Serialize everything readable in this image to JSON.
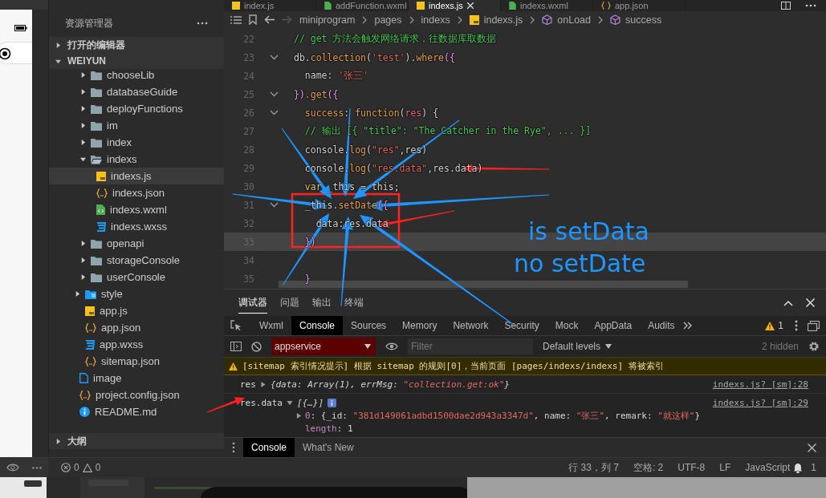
{
  "editor_tabs": [
    {
      "label": "index.js",
      "kind": "js",
      "selected": false
    },
    {
      "label": "addFunction.wxml",
      "kind": "wxml",
      "selected": false
    },
    {
      "label": "indexs.js",
      "kind": "js",
      "selected": true
    },
    {
      "label": "indexs.wxml",
      "kind": "wxml",
      "selected": false
    },
    {
      "label": "app.json",
      "kind": "json",
      "selected": false
    }
  ],
  "breadcrumb": [
    {
      "label": "miniprogram",
      "kind": "folder"
    },
    {
      "label": "pages",
      "kind": "folder"
    },
    {
      "label": "indexs",
      "kind": "folder"
    },
    {
      "label": "indexs.js",
      "kind": "js"
    },
    {
      "label": "onLoad",
      "kind": "symbol"
    },
    {
      "label": "success",
      "kind": "symbol"
    }
  ],
  "explorer": {
    "title": "资源管理器",
    "sections": [
      {
        "label": "打开的编辑器",
        "expanded": false
      },
      {
        "label": "WEIYUN",
        "expanded": true
      }
    ],
    "tree": [
      {
        "children": [
          {
            "children": [
              {
                "label": "chooseLib",
                "kind": "folder",
                "expanded": false,
                "selected": false
              },
              {
                "label": "databaseGuide",
                "kind": "folder",
                "expanded": false,
                "selected": false
              },
              {
                "label": "deployFunctions",
                "kind": "folder",
                "expanded": false,
                "selected": false
              },
              {
                "label": "im",
                "kind": "folder",
                "expanded": false,
                "selected": false
              },
              {
                "label": "index",
                "kind": "folder",
                "expanded": false,
                "selected": false
              },
              {
                "label": "indexs",
                "kind": "folder",
                "expanded": true,
                "selected": false,
                "children": [
                  {
                    "label": "indexs.js",
                    "kind": "js",
                    "selected": true
                  },
                  {
                    "label": "indexs.json",
                    "kind": "json",
                    "selected": false
                  },
                  {
                    "label": "indexs.wxml",
                    "kind": "wxml",
                    "selected": false
                  },
                  {
                    "label": "indexs.wxss",
                    "kind": "wxss",
                    "selected": false
                  }
                ]
              },
              {
                "label": "openapi",
                "kind": "folder",
                "expanded": false,
                "selected": false
              },
              {
                "label": "storageConsole",
                "kind": "folder",
                "expanded": false,
                "selected": false
              },
              {
                "label": "userConsole",
                "kind": "folder",
                "expanded": false,
                "selected": false
              }
            ]
          },
          {
            "label": "style",
            "kind": "style-folder",
            "expanded": false,
            "selected": false
          },
          {
            "label": "app.js",
            "kind": "js",
            "selected": false
          },
          {
            "label": "app.json",
            "kind": "json",
            "selected": false
          },
          {
            "label": "app.wxss",
            "kind": "wxss",
            "selected": false
          },
          {
            "label": "sitemap.json",
            "kind": "json",
            "selected": false
          }
        ]
      },
      {
        "label": "image",
        "kind": "image",
        "selected": false
      },
      {
        "label": "project.config.json",
        "kind": "json",
        "selected": false
      },
      {
        "label": "README.md",
        "kind": "info",
        "selected": false
      }
    ],
    "outline": {
      "label": "大纲",
      "expanded": false
    }
  },
  "code": [
    {
      "number": "22",
      "fold": false,
      "current": false,
      "segments": [
        {
          "text": "// get 方法会触发网络请求，往数据库取数据",
          "kind": "comment"
        }
      ]
    },
    {
      "number": "23",
      "fold": true,
      "current": false,
      "segments": [
        {
          "text": "db.",
          "kind": "plain"
        },
        {
          "text": "collection",
          "kind": "func"
        },
        {
          "text": "(",
          "kind": "plain"
        },
        {
          "text": "'test'",
          "kind": "string"
        },
        {
          "text": ").",
          "kind": "plain"
        },
        {
          "text": "where",
          "kind": "func"
        },
        {
          "text": "({",
          "kind": "punct"
        }
      ]
    },
    {
      "number": "24",
      "fold": false,
      "current": false,
      "segments": [
        {
          "text": "  name: ",
          "kind": "plain"
        },
        {
          "text": "'张三'",
          "kind": "string"
        }
      ]
    },
    {
      "number": "25",
      "fold": true,
      "current": false,
      "segments": [
        {
          "text": "})",
          "kind": "punct"
        },
        {
          "text": ".get",
          "kind": "func"
        },
        {
          "text": "({",
          "kind": "punct"
        }
      ]
    },
    {
      "number": "26",
      "fold": true,
      "current": false,
      "segments": [
        {
          "text": "  success",
          "kind": "func"
        },
        {
          "text": ": ",
          "kind": "plain"
        },
        {
          "text": "function",
          "kind": "func"
        },
        {
          "text": "(",
          "kind": "plain"
        },
        {
          "text": "res",
          "kind": "param"
        },
        {
          "text": ") {",
          "kind": "plain"
        }
      ]
    },
    {
      "number": "27",
      "fold": false,
      "current": false,
      "segments": [
        {
          "text": "  // 输出 [{ \"title\": \"The Catcher in the Rye\", ... }]",
          "kind": "comment"
        }
      ]
    },
    {
      "number": "28",
      "fold": false,
      "current": false,
      "segments": [
        {
          "text": "  console.",
          "kind": "plain"
        },
        {
          "text": "log",
          "kind": "func"
        },
        {
          "text": "(",
          "kind": "plain"
        },
        {
          "text": "\"res\"",
          "kind": "string"
        },
        {
          "text": ",res)",
          "kind": "plain"
        }
      ]
    },
    {
      "number": "29",
      "fold": false,
      "current": false,
      "segments": [
        {
          "text": "  console.",
          "kind": "plain"
        },
        {
          "text": "log",
          "kind": "func"
        },
        {
          "text": "(",
          "kind": "plain"
        },
        {
          "text": "\"res.data\"",
          "kind": "string"
        },
        {
          "text": ",res.data)",
          "kind": "plain"
        }
      ]
    },
    {
      "number": "30",
      "fold": false,
      "current": false,
      "segments": [
        {
          "text": "  var",
          "kind": "keyword"
        },
        {
          "text": " _this = this;",
          "kind": "plain"
        }
      ]
    },
    {
      "number": "31",
      "fold": true,
      "current": false,
      "segments": [
        {
          "text": "  _this.",
          "kind": "plain"
        },
        {
          "text": "setDate",
          "kind": "func"
        },
        {
          "text": "({",
          "kind": "punct"
        }
      ]
    },
    {
      "number": "32",
      "fold": false,
      "current": false,
      "segments": [
        {
          "text": "    data:res.data",
          "kind": "plain"
        }
      ]
    },
    {
      "number": "33",
      "fold": false,
      "current": true,
      "segments": [
        {
          "text": "  })",
          "kind": "punct"
        }
      ]
    },
    {
      "number": "34",
      "fold": false,
      "current": false
    },
    {
      "number": "35",
      "fold": false,
      "current": false,
      "segments": [
        {
          "text": "  }",
          "kind": "punct"
        }
      ]
    }
  ],
  "annotations": [
    "is setData",
    "no setDate"
  ],
  "devtools": {
    "panel_tabs": [
      {
        "label": "调试器",
        "selected": true
      },
      {
        "label": "问题",
        "selected": false
      },
      {
        "label": "输出",
        "selected": false
      },
      {
        "label": "终端",
        "selected": false
      }
    ],
    "tool_tabs": [
      {
        "label": "Wxml",
        "selected": false
      },
      {
        "label": "Console",
        "selected": true
      },
      {
        "label": "Sources",
        "selected": false
      },
      {
        "label": "Memory",
        "selected": false
      },
      {
        "label": "Network",
        "selected": false
      },
      {
        "label": "Security",
        "selected": false
      },
      {
        "label": "Mock",
        "selected": false
      },
      {
        "label": "AppData",
        "selected": false
      },
      {
        "label": "Audits",
        "selected": false
      }
    ],
    "warning_count": "1",
    "context": "appservice",
    "filter_placeholder": "Filter",
    "levels": "Default levels",
    "hidden": "2 hidden",
    "messages": [
      {
        "kind": "warning",
        "text": "[sitemap 索引情况提示] 根据 sitemap 的规则[0]，当前页面 [pages/indexs/indexs] 将被索引"
      },
      {
        "kind": "log",
        "label": "res",
        "expanded": false,
        "preview": [
          {
            "text": "{data: Array(1), errMsg: ",
            "kind": "plain"
          },
          {
            "text": "\"collection.get:ok\"",
            "kind": "string"
          },
          {
            "text": "}",
            "kind": "plain"
          }
        ],
        "source": "indexs.js? [sm]:28"
      },
      {
        "kind": "log",
        "label": "res.data",
        "expanded": true,
        "info_badge": true,
        "preview": [
          {
            "text": "[{…}]",
            "kind": "plain"
          }
        ],
        "source": "indexs.js? [sm]:29",
        "children": [
          {
            "expanded": false,
            "segments": [
              {
                "text": "0",
                "kind": "key"
              },
              {
                "text": ": {_id: ",
                "kind": "plain"
              },
              {
                "text": "\"381d149061adbd1500dae2d943a3347d\"",
                "kind": "string"
              },
              {
                "text": ", name: ",
                "kind": "plain"
              },
              {
                "text": "\"张三\"",
                "kind": "string"
              },
              {
                "text": ", remark: ",
                "kind": "plain"
              },
              {
                "text": "\"就这样\"",
                "kind": "string"
              },
              {
                "text": "}",
                "kind": "plain"
              }
            ]
          },
          {
            "segments": [
              {
                "text": "length",
                "kind": "key"
              },
              {
                "text": ": 1",
                "kind": "plain"
              }
            ]
          }
        ]
      }
    ],
    "drawer_tabs": [
      {
        "label": "Console",
        "selected": true
      },
      {
        "label": "What's New",
        "selected": false
      }
    ]
  },
  "status_bar": {
    "errors": "0",
    "warnings": "0",
    "position": "行 33，列 7",
    "indent": "空格: 2",
    "encoding": "UTF-8",
    "eol": "LF",
    "language": "JavaScript",
    "notifications": "1"
  }
}
